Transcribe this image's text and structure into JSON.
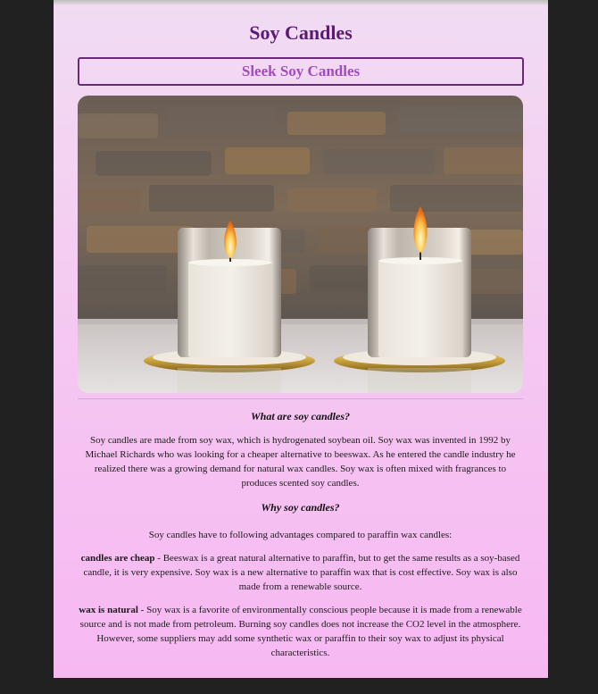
{
  "page": {
    "title": "Soy Candles",
    "subtitle": "Sleek Soy Candles"
  },
  "hero": {
    "image": "two-candles-photo"
  },
  "sections": {
    "what": {
      "heading": "What are soy candles?",
      "body": "Soy candles are made from soy wax, which is hydrogenated soybean oil. Soy wax was invented in 1992 by Michael Richards who was looking for a cheaper alternative to beeswax. As he entered the candle industry he realized there was a growing demand for natural wax candles. Soy wax is often mixed with fragrances to produces scented soy candles."
    },
    "why": {
      "heading": "Why soy candles?",
      "intro": "Soy candles have to following advantages compared to paraffin wax candles:",
      "cheap_term": "candles are cheap",
      "cheap_body": " - Beeswax is a great natural alternative to paraffin, but to get the same results as a soy-based candle, it is very expensive. Soy wax is a new alternative to paraffin wax that is cost effective. Soy wax is also made from a renewable source.",
      "natural_term": "wax is natural",
      "natural_body": " - Soy wax is a favorite of environmentally conscious people because it is made from a renewable source and is not made from petroleum. Burning soy candles does not increase the CO2 level in the atmosphere. However, some suppliers may add some synthetic wax or paraffin to their soy wax to adjust its physical characteristics."
    }
  },
  "colors": {
    "title": "#5b1b73",
    "subtitle": "#a24cc0",
    "background_top": "#f1dcf3",
    "background_bottom": "#f7b8f2",
    "outer": "#212121"
  }
}
